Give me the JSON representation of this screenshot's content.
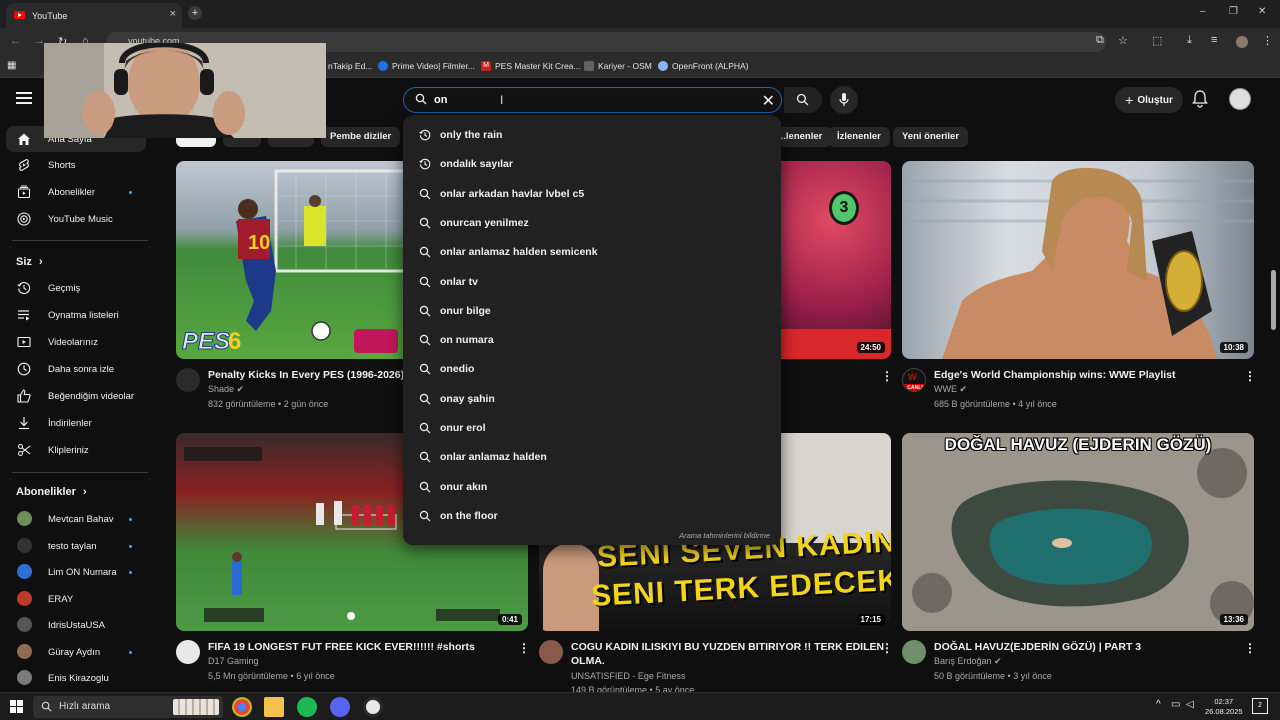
{
  "browser": {
    "tab_title": "YouTube",
    "tab_close": "×",
    "new_tab": "+",
    "url": "youtube.com",
    "bookmarks": [
      {
        "label": "nTakip Ed...",
        "color": "#d93025",
        "glyph": ""
      },
      {
        "label": "Prime Video| Filmler...",
        "color": "#1a73e8",
        "glyph": ""
      },
      {
        "label": "PES Master Kit Crea...",
        "color": "#c5221f",
        "glyph": "M"
      },
      {
        "label": "Kariyer - OSM",
        "color": "#5f6368",
        "glyph": ""
      },
      {
        "label": "OpenFront (ALPHA)",
        "color": "#8ab4f8",
        "glyph": ""
      }
    ],
    "window_controls": [
      "–",
      "❐",
      "✕"
    ]
  },
  "header": {
    "search_query": "on",
    "clear_glyph": "✕",
    "create_label": "Oluştur",
    "create_plus": "+"
  },
  "suggestions": {
    "items": [
      {
        "text": "only the rain",
        "icon": "history-icon"
      },
      {
        "text": "ondalık sayılar",
        "icon": "history-icon"
      },
      {
        "text": "onlar arkadan havlar lvbel c5",
        "icon": "search-icon"
      },
      {
        "text": "onurcan yenilmez",
        "icon": "search-icon"
      },
      {
        "text": "onlar anlamaz halden semicenk",
        "icon": "search-icon"
      },
      {
        "text": "onlar tv",
        "icon": "search-icon"
      },
      {
        "text": "onur bilge",
        "icon": "search-icon"
      },
      {
        "text": "on numara",
        "icon": "search-icon"
      },
      {
        "text": "onedio",
        "icon": "search-icon"
      },
      {
        "text": "onay şahin",
        "icon": "search-icon"
      },
      {
        "text": "onur erol",
        "icon": "search-icon"
      },
      {
        "text": "onlar anlamaz halden",
        "icon": "search-icon"
      },
      {
        "text": "onur akın",
        "icon": "search-icon"
      },
      {
        "text": "on the floor",
        "icon": "search-icon"
      }
    ],
    "report_label": "Arama tahminlerini bildirme"
  },
  "sidebar": {
    "top_items": [
      {
        "label": "Ana Sayfa",
        "icon": "home-icon"
      },
      {
        "label": "Shorts",
        "icon": "shorts-icon"
      },
      {
        "label": "Abonelikler",
        "icon": "subscriptions-icon",
        "dot": true
      },
      {
        "label": "YouTube Music",
        "icon": "music-icon"
      }
    ],
    "you_heading": "Siz",
    "you_chevron": "›",
    "you_items": [
      {
        "label": "Geçmiş",
        "icon": "history-icon"
      },
      {
        "label": "Oynatma listeleri",
        "icon": "playlist-icon"
      },
      {
        "label": "Videolarınız",
        "icon": "video-icon"
      },
      {
        "label": "Daha sonra izle",
        "icon": "clock-icon"
      },
      {
        "label": "Beğendiğim videolar",
        "icon": "thumbs-up-icon"
      },
      {
        "label": "İndirilenler",
        "icon": "download-icon"
      },
      {
        "label": "Klipleriniz",
        "icon": "scissors-icon"
      }
    ],
    "subs_heading": "Abonelikler",
    "subs_chevron": "›",
    "subscriptions": [
      {
        "label": "Mevtcan Bahav",
        "color": "#6b8e5a",
        "dot": true
      },
      {
        "label": "testo taylan",
        "color": "#333333",
        "dot": true
      },
      {
        "label": "Lim ON Numara",
        "color": "#2f6fd6",
        "dot": true
      },
      {
        "label": "ERAY",
        "color": "#c0392b",
        "dot": false
      },
      {
        "label": "IdrisUstaUSA",
        "color": "#555555",
        "dot": false
      },
      {
        "label": "Güray Aydın",
        "color": "#8e6e4e",
        "dot": true
      },
      {
        "label": "Enis Kirazoglu",
        "color": "#7a7a7a",
        "dot": false
      }
    ]
  },
  "chips": [
    "Pembe diziler",
    "...lenenler",
    "İzlenenler",
    "Yeni öneriler"
  ],
  "videos": [
    {
      "title": "Penalty Kicks In Every PES (1996-2026)",
      "title2": "",
      "channel": "Shade",
      "verified": true,
      "meta": "832 görüntüleme • 2 gün önce",
      "duration": "",
      "avatar_color": "#2a2a2a"
    },
    {
      "title": "",
      "title2": "",
      "channel": "",
      "verified": false,
      "meta": "",
      "duration": "24:50",
      "avatar_color": "#333333"
    },
    {
      "title": "Edge's World Championship wins: WWE Playlist",
      "title2": "",
      "channel": "WWE",
      "verified": true,
      "meta": "685 B görüntüleme • 4 yıl önce",
      "duration": "10:38",
      "avatar_color": "#111111",
      "avatar_text": "CANLI"
    },
    {
      "title": "FIFA 19 LONGEST FUT FREE KICK EVER!!!!!! #shorts",
      "title2": "",
      "channel": "D17 Gaming",
      "verified": false,
      "meta": "5,5 Mn görüntüleme • 6 yıl önce",
      "duration": "0:41",
      "avatar_color": "#e8e8e8"
    },
    {
      "title": "COGU KADIN ILISKIYI BU YUZDEN BITIRIYOR !! TERK EDILEN",
      "title2": "OLMA.",
      "channel": "UNSATISFIED - Ege Fitness",
      "verified": false,
      "meta": "149 B görüntüleme • 5 ay önce",
      "duration": "17:15",
      "avatar_color": "#8a5a4a",
      "thumb_line1": "SENI SEVEN KADIN",
      "thumb_line2": "SENI TERK EDECEK !!"
    },
    {
      "title": "DOĞAL HAVUZ(EJDERİN GÖZÜ) | PART 3",
      "title2": "",
      "channel": "Barış Erdoğan",
      "verified": true,
      "meta": "50 B görüntüleme • 3 yıl önce",
      "duration": "13:36",
      "avatar_color": "#6f8f6a",
      "thumb_text": "DOĞAL HAVUZ (EJDERIN GÖZÜ)"
    }
  ],
  "taskbar": {
    "search_label": "Hızlı arama",
    "time": "02:37",
    "date": "26.08.2025",
    "notif_count": "2"
  }
}
